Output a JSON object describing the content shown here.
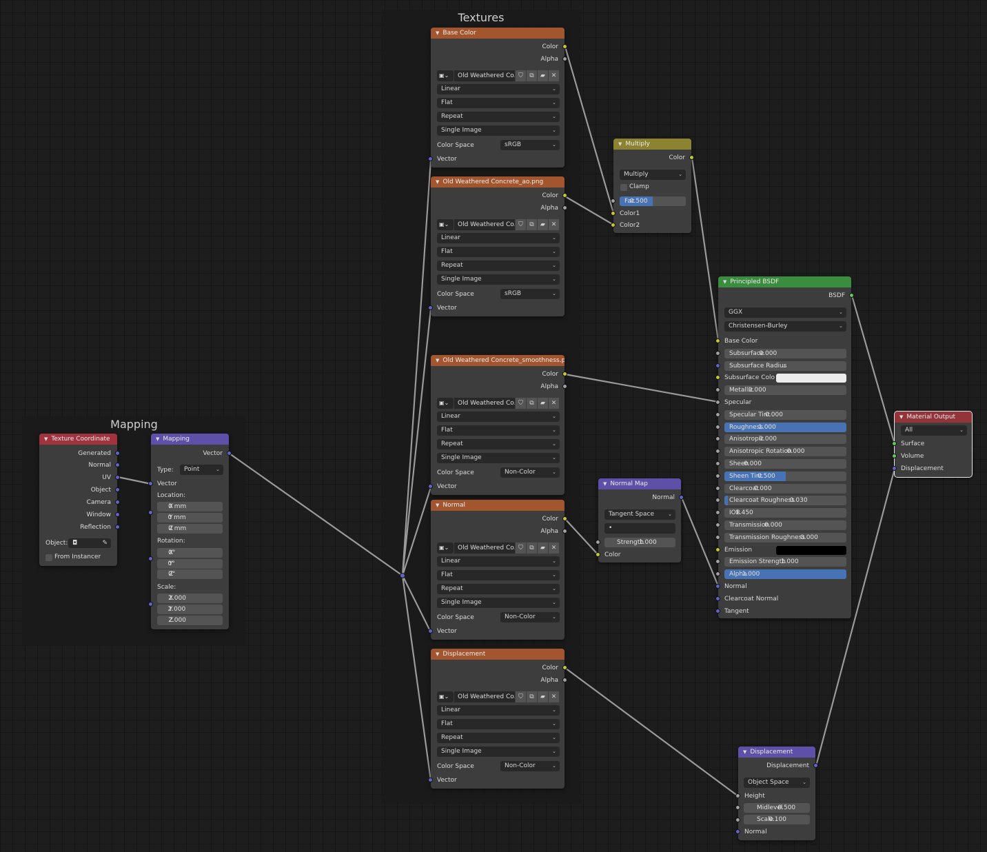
{
  "frames": {
    "mapping_title": "Mapping",
    "textures_title": "Textures"
  },
  "colors": {
    "texture_header": "#a3562e",
    "color_header": "#8c8331",
    "vector_header": "#5e4fa8",
    "shader_header": "#3a8c3f",
    "input_header": "#a1333f",
    "output_header": "#93333a",
    "selection_blue": "#4772b3",
    "socket_yellow": "#c7c729",
    "socket_grey": "#a1a1a1",
    "socket_blue": "#6363c7",
    "socket_green": "#63c763"
  },
  "texcoord": {
    "title": "Texture Coordinate",
    "outputs": [
      "Generated",
      "Normal",
      "UV",
      "Object",
      "Camera",
      "Window",
      "Reflection"
    ],
    "object_label": "Object:",
    "from_instancer": "From Instancer"
  },
  "mapping": {
    "title": "Mapping",
    "out_vector": "Vector",
    "type_label": "Type:",
    "type_value": "Point",
    "in_vector": "Vector",
    "location_label": "Location:",
    "location": [
      {
        "axis": "X",
        "value": "0 mm"
      },
      {
        "axis": "Y",
        "value": "0 mm"
      },
      {
        "axis": "Z",
        "value": "0 mm"
      }
    ],
    "rotation_label": "Rotation:",
    "rotation": [
      {
        "axis": "X",
        "value": "0°"
      },
      {
        "axis": "Y",
        "value": "0°"
      },
      {
        "axis": "Z",
        "value": "0°"
      }
    ],
    "scale_label": "Scale:",
    "scale": [
      {
        "axis": "X",
        "value": "2.000"
      },
      {
        "axis": "Y",
        "value": "2.000"
      },
      {
        "axis": "Z",
        "value": "2.000"
      }
    ]
  },
  "textures": [
    {
      "title": "Base Color",
      "out_color": "Color",
      "out_alpha": "Alpha",
      "image": "Old Weathered Co...",
      "interpolation": "Linear",
      "projection": "Flat",
      "extension": "Repeat",
      "source": "Single Image",
      "colorspace_label": "Color Space",
      "colorspace": "sRGB",
      "in_vector": "Vector"
    },
    {
      "title": "Old Weathered Concrete_ao.png",
      "out_color": "Color",
      "out_alpha": "Alpha",
      "image": "Old Weathered Co...",
      "interpolation": "Linear",
      "projection": "Flat",
      "extension": "Repeat",
      "source": "Single Image",
      "colorspace_label": "Color Space",
      "colorspace": "sRGB",
      "in_vector": "Vector"
    },
    {
      "title": "Old Weathered Concrete_smoothness.png",
      "out_color": "Color",
      "out_alpha": "Alpha",
      "image": "Old Weathered Co...",
      "interpolation": "Linear",
      "projection": "Flat",
      "extension": "Repeat",
      "source": "Single Image",
      "colorspace_label": "Color Space",
      "colorspace": "Non-Color",
      "in_vector": "Vector"
    },
    {
      "title": "Normal",
      "out_color": "Color",
      "out_alpha": "Alpha",
      "image": "Old Weathered Co...",
      "interpolation": "Linear",
      "projection": "Flat",
      "extension": "Repeat",
      "source": "Single Image",
      "colorspace_label": "Color Space",
      "colorspace": "Non-Color",
      "in_vector": "Vector"
    },
    {
      "title": "Displacement",
      "out_color": "Color",
      "out_alpha": "Alpha",
      "image": "Old Weathered Co...",
      "interpolation": "Linear",
      "projection": "Flat",
      "extension": "Repeat",
      "source": "Single Image",
      "colorspace_label": "Color Space",
      "colorspace": "Non-Color",
      "in_vector": "Vector"
    }
  ],
  "multiply": {
    "title": "Multiply",
    "out_color": "Color",
    "blend": "Multiply",
    "clamp": "Clamp",
    "fac_label": "Fac",
    "fac_value": "0.500",
    "fac": 0.5,
    "color1": "Color1",
    "color2": "Color2"
  },
  "normalmap": {
    "title": "Normal Map",
    "out_normal": "Normal",
    "space": "Tangent Space",
    "uv_map": "•",
    "strength_label": "Strength",
    "strength_value": "1.000",
    "in_color": "Color"
  },
  "bsdf": {
    "title": "Principled BSDF",
    "out": "BSDF",
    "distribution": "GGX",
    "subsurface_method": "Christensen-Burley",
    "base_color": "Base Color",
    "subsurface": {
      "label": "Subsurface",
      "value": "0.000"
    },
    "subsurface_radius": "Subsurface Radius",
    "subsurface_color": "Subsurface Colo",
    "metallic": {
      "label": "Metallic",
      "value": "0.000"
    },
    "specular": "Specular",
    "specular_tint": {
      "label": "Specular Tint",
      "value": "0.000"
    },
    "roughness": {
      "label": "Roughness",
      "value": "1.000",
      "fill": 1.0
    },
    "anisotropic": {
      "label": "Anisotropic",
      "value": "0.000"
    },
    "anisotropic_rotation": {
      "label": "Anisotropic Rotation",
      "value": "0.000"
    },
    "sheen": {
      "label": "Sheen",
      "value": "0.000"
    },
    "sheen_tint": {
      "label": "Sheen Tint",
      "value": "0.500",
      "fill": 0.5
    },
    "clearcoat": {
      "label": "Clearcoat",
      "value": "0.000"
    },
    "clearcoat_roughness": {
      "label": "Clearcoat Roughness",
      "value": "0.030",
      "fill": 0.03
    },
    "ior": {
      "label": "IOR",
      "value": "1.450"
    },
    "transmission": {
      "label": "Transmission",
      "value": "0.000"
    },
    "transmission_roughness": {
      "label": "Transmission Roughness",
      "value": "0.000"
    },
    "emission": "Emission",
    "emission_strength": {
      "label": "Emission Strength",
      "value": "1.000"
    },
    "alpha": {
      "label": "Alpha",
      "value": "1.000",
      "fill": 1.0
    },
    "normal": "Normal",
    "clearcoat_normal": "Clearcoat Normal",
    "tangent": "Tangent"
  },
  "output": {
    "title": "Material Output",
    "target": "All",
    "surface": "Surface",
    "volume": "Volume",
    "displacement": "Displacement"
  },
  "displacement": {
    "title": "Displacement",
    "out": "Displacement",
    "space": "Object Space",
    "height": "Height",
    "midlevel": {
      "label": "Midlevel",
      "value": "0.500"
    },
    "scale": {
      "label": "Scale",
      "value": "0.100"
    },
    "normal": "Normal"
  }
}
